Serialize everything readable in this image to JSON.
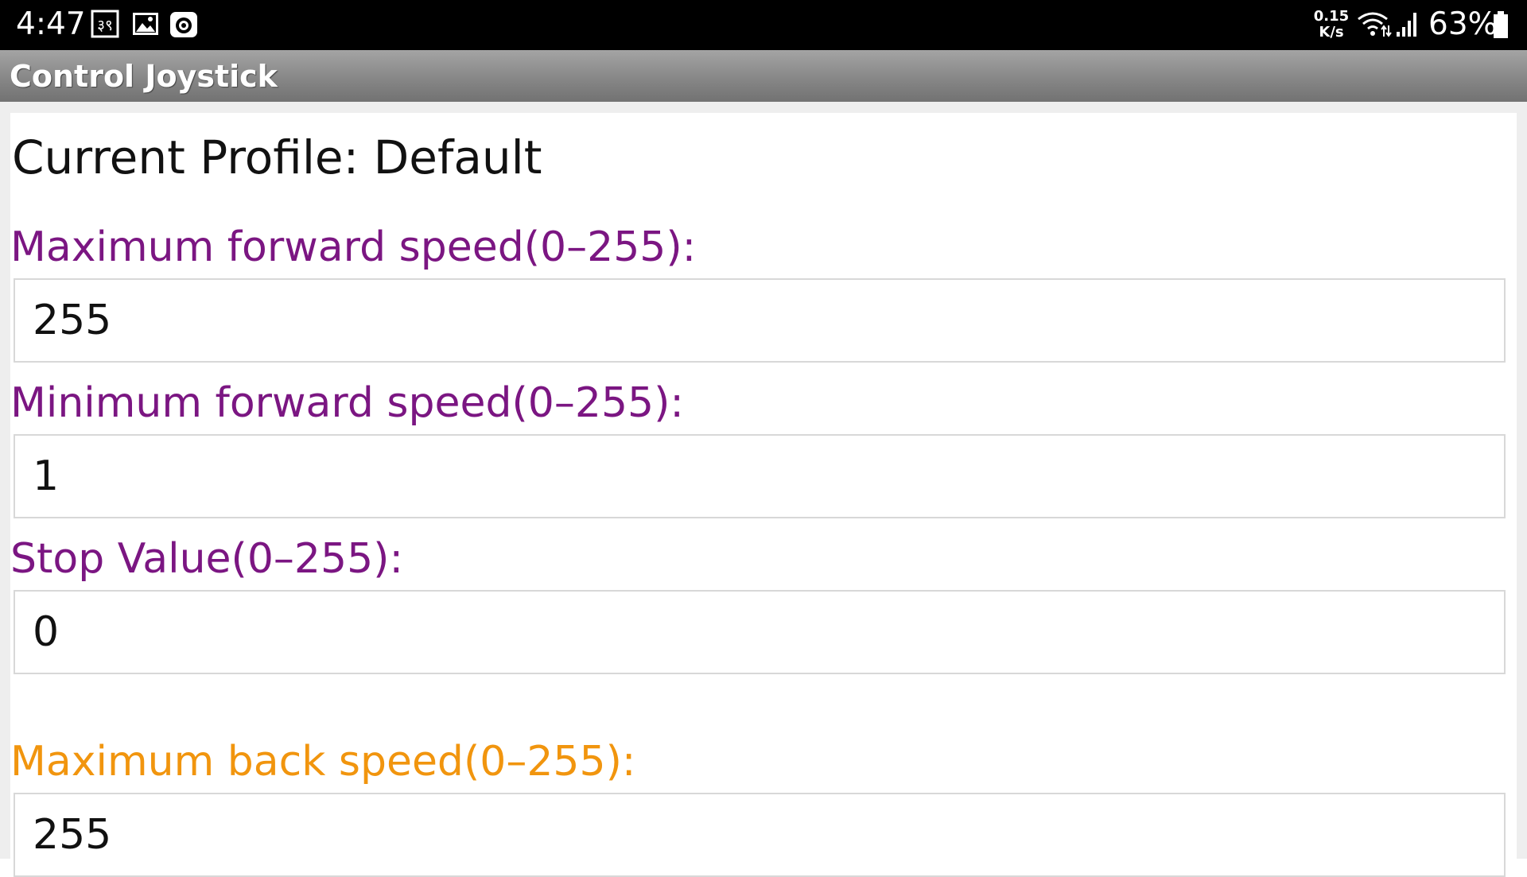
{
  "status_bar": {
    "time": "4:47",
    "icons_left": [
      "notification-app-icon",
      "image-icon",
      "camera-sync-icon"
    ],
    "net_speed_value": "0.15",
    "net_speed_unit": "K/s",
    "icons_right": [
      "wifi-icon",
      "signal-icon"
    ],
    "battery_percent": "63%",
    "battery_icon": "battery-icon"
  },
  "app_bar": {
    "title": "Control Joystick"
  },
  "profile": {
    "text": "Current Profile: Default"
  },
  "fields": [
    {
      "label": "Maximum forward speed(0–255):",
      "value": "255",
      "label_color": "#7b1682"
    },
    {
      "label": "Minimum forward speed(0–255):",
      "value": "1",
      "label_color": "#7b1682"
    },
    {
      "label": "Stop Value(0–255):",
      "value": "0",
      "label_color": "#7b1682"
    },
    {
      "label": "Maximum back speed(0–255):",
      "value": "255",
      "label_color": "#f1950e"
    }
  ],
  "colors": {
    "status_bar_bg": "#000000",
    "title_bar_bg": "#8a8a8a",
    "forward_label": "#7b1682",
    "back_label": "#f1950e"
  }
}
